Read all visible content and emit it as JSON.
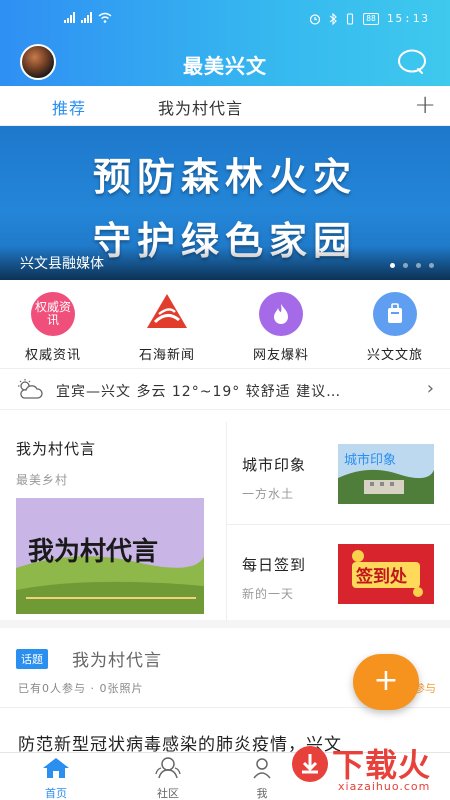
{
  "colors": {
    "accent": "#2b8ff0",
    "fab": "#f6921e",
    "watermark": "#e8403a"
  },
  "status": {
    "time": "15:13",
    "battery": "88"
  },
  "header": {
    "title": "最美兴文"
  },
  "tabs": [
    {
      "label": "推荐",
      "active": true
    },
    {
      "label": "我为村代言",
      "active": false
    }
  ],
  "banner": {
    "line1": "预防森林火灾",
    "line2": "守护绿色家园",
    "caption": "兴文县融媒体"
  },
  "quick": [
    {
      "label": "权威资讯",
      "icon_text": "权威资讯",
      "icon": "authority-news-icon"
    },
    {
      "label": "石海新闻",
      "icon": "shihai-logo-icon"
    },
    {
      "label": "网友爆料",
      "icon": "flame-icon"
    },
    {
      "label": "兴文文旅",
      "icon": "luggage-icon"
    }
  ],
  "weather": {
    "text": "宜宾—兴文  多云  12°~19°  较舒适  建议…",
    "icon": "cloud-sun-icon"
  },
  "left_card": {
    "title": "我为村代言",
    "subtitle": "最美乡村",
    "image_text": "我为村代言"
  },
  "right_cards": [
    {
      "title": "城市印象",
      "subtitle": "一方水土",
      "image_text": "城市印象"
    },
    {
      "title": "每日签到",
      "subtitle": "新的一天",
      "image_text": "签到处"
    }
  ],
  "topic": {
    "tag": "话题",
    "title": "我为村代言",
    "meta": "已有0人参与 · 0张照片",
    "join": "参与"
  },
  "fab": {
    "label": "+"
  },
  "news": {
    "title": "防范新型冠状病毒感染的肺炎疫情，兴文"
  },
  "bottom_nav": [
    {
      "label": "首页"
    },
    {
      "label": "社区"
    },
    {
      "label": "我"
    }
  ],
  "watermark": {
    "text": "下载火",
    "url": "xiazaihuo.com"
  }
}
